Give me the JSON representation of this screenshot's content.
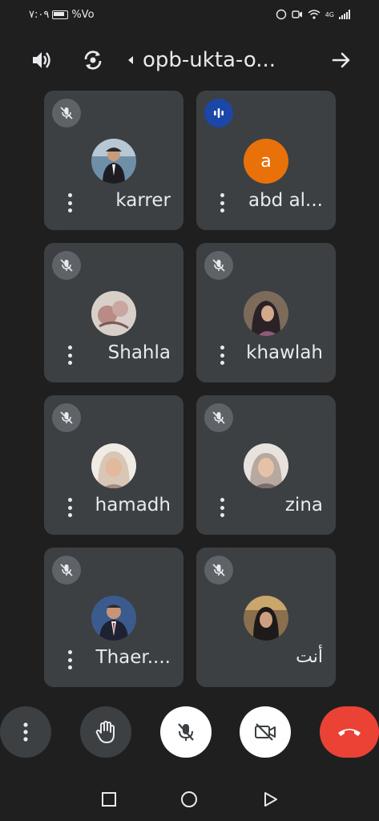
{
  "status_bar": {
    "time": "٧:٠٩",
    "battery_percent": "%Vo",
    "network": "4G"
  },
  "header": {
    "meeting_code": "opb-ukta-o..."
  },
  "participants": [
    {
      "name": "karrer",
      "avatar_type": "photo",
      "mic": "muted"
    },
    {
      "name": "abd al...",
      "avatar_type": "letter",
      "avatar_letter": "a",
      "mic": "speaking"
    },
    {
      "name": "Shahla",
      "avatar_type": "photo",
      "mic": "muted"
    },
    {
      "name": "khawlah",
      "avatar_type": "photo",
      "mic": "muted"
    },
    {
      "name": "hamadh",
      "avatar_type": "photo",
      "mic": "muted"
    },
    {
      "name": "zina",
      "avatar_type": "photo",
      "mic": "muted"
    },
    {
      "name": "Thaer....",
      "avatar_type": "photo",
      "mic": "muted"
    },
    {
      "name": "أنت",
      "avatar_type": "photo",
      "mic": "muted"
    }
  ],
  "controls": [
    {
      "icon": "more-vert-icon"
    },
    {
      "icon": "raise-hand-icon"
    },
    {
      "icon": "mic-off-icon"
    },
    {
      "icon": "videocam-off-icon"
    },
    {
      "icon": "call-end-icon"
    }
  ],
  "colors": {
    "background": "#1f1f1f",
    "tile": "#3c4043",
    "end_call": "#ea4335",
    "speaking": "#1a47a8",
    "letter_avatar": "#e8710a"
  }
}
